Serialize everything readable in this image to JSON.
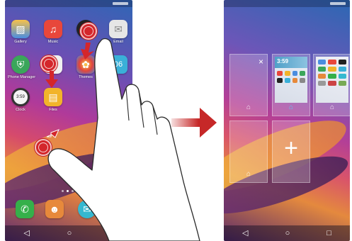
{
  "left_screen": {
    "apps": [
      {
        "label": "Gallery",
        "color": "#4a8de0",
        "glyph": "▨"
      },
      {
        "label": "Music",
        "color": "#e8473b",
        "glyph": "♫"
      },
      {
        "label": "",
        "color": "#222222",
        "glyph": "●"
      },
      {
        "label": "Email",
        "color": "#dcdcdc",
        "glyph": "✉"
      },
      {
        "label": "Phone Manager",
        "color": "#3aa65a",
        "glyph": "⛨"
      },
      {
        "label": "",
        "color": "#f0f0f0",
        "glyph": ""
      },
      {
        "label": "Themes",
        "color": "#f2f2f2",
        "glyph": "✿"
      },
      {
        "label": "",
        "color": "#3ab0d8",
        "glyph": "06"
      },
      {
        "label": "Clock",
        "color": "#f4f4f4",
        "glyph": "3:59"
      },
      {
        "label": "Files",
        "color": "#f2b42a",
        "glyph": "▤"
      }
    ],
    "dock": [
      {
        "name": "phone",
        "color": "#35b04a",
        "glyph": "✆"
      },
      {
        "name": "contacts",
        "color": "#e7893b",
        "glyph": "☻"
      },
      {
        "name": "messages",
        "color": "#35b8d0",
        "glyph": "✉"
      }
    ],
    "nav": {
      "back": "◁",
      "home": "○",
      "recent": "□"
    }
  },
  "right_screen": {
    "thumb_time": "3:59",
    "close_glyph": "×",
    "home_glyph": "⌂",
    "add_glyph": "+",
    "nav": {
      "back": "◁",
      "home": "○",
      "recent": "□"
    }
  },
  "colors": {
    "gesture": "#d4262b",
    "arrow": "#c62828"
  }
}
